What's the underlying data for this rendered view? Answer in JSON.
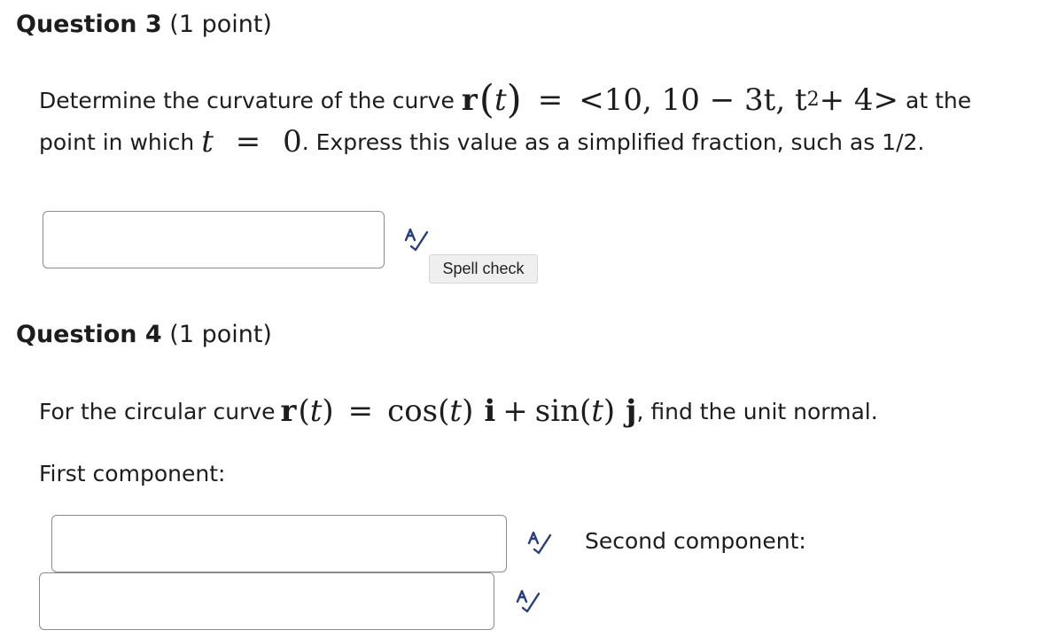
{
  "question3": {
    "title": "Question 3",
    "points": "(1 point)",
    "text_before": "Determine the curvature of the curve",
    "math_r": "r",
    "math_t": "t",
    "math_eq": "=",
    "math_vector": "<10, 10 − 3t, t",
    "math_exp": "2",
    "math_vector_end": " + 4>",
    "text_after": "at the",
    "line2_before": "point in which",
    "line2_t": "t",
    "line2_eq": "=",
    "line2_zero": "0",
    "line2_after": ". Express this value as a simplified fraction, such as 1/2.",
    "answer_value": "",
    "spell_tooltip": "Spell check"
  },
  "question4": {
    "title": "Question 4",
    "points": "(1 point)",
    "text_before": "For the circular curve",
    "math_r": "r",
    "math_lp": "(",
    "math_t": "t",
    "math_rp": ")",
    "math_eq": "=",
    "math_cos": "cos(",
    "math_t2": "t",
    "math_cos_end": ")",
    "math_i": "i",
    "math_plus": "+",
    "math_sin": "sin(",
    "math_t3": "t",
    "math_sin_end": ")",
    "math_j": "j",
    "text_after": ", find the unit normal.",
    "first_label": "First component:",
    "second_label": "Second component:",
    "first_value": "",
    "second_value": ""
  },
  "colors": {
    "spell_icon": "#2a3d7c",
    "text": "#1d1d1f"
  },
  "icons": {
    "spell_check": "spell-check-icon"
  }
}
